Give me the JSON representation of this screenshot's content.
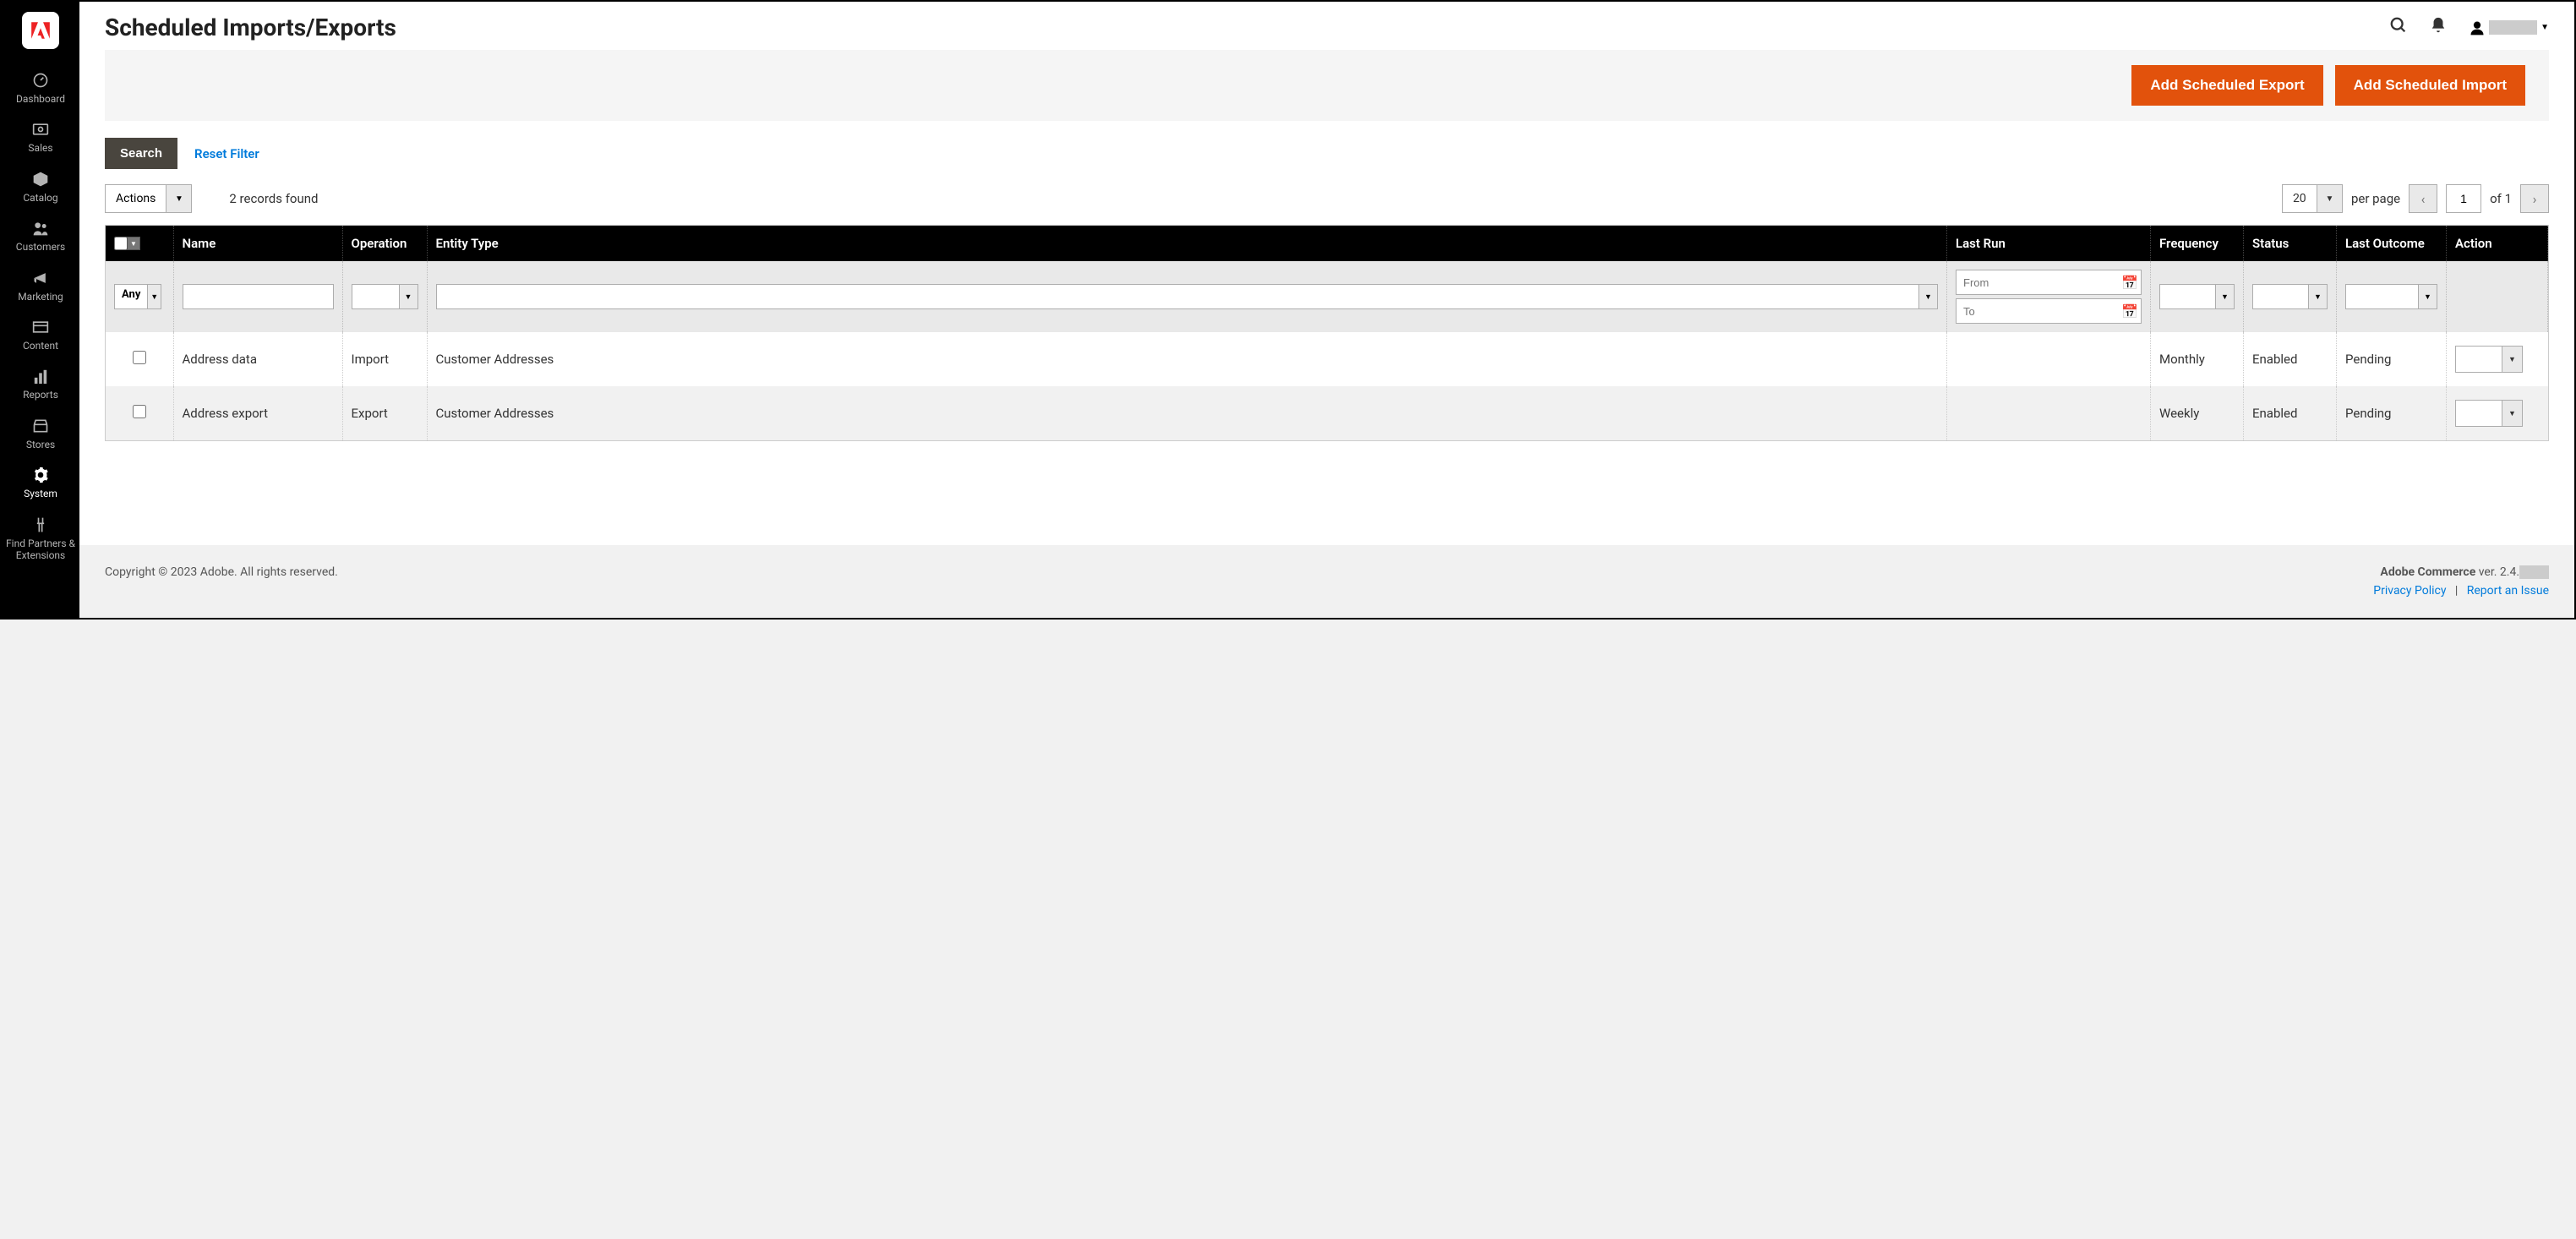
{
  "sidebar": {
    "items": [
      {
        "label": "Dashboard",
        "icon": "dashboard"
      },
      {
        "label": "Sales",
        "icon": "sales"
      },
      {
        "label": "Catalog",
        "icon": "catalog"
      },
      {
        "label": "Customers",
        "icon": "customers"
      },
      {
        "label": "Marketing",
        "icon": "marketing"
      },
      {
        "label": "Content",
        "icon": "content"
      },
      {
        "label": "Reports",
        "icon": "reports"
      },
      {
        "label": "Stores",
        "icon": "stores"
      },
      {
        "label": "System",
        "icon": "system",
        "active": true
      },
      {
        "label": "Find Partners & Extensions",
        "icon": "partners"
      }
    ]
  },
  "header": {
    "title": "Scheduled Imports/Exports"
  },
  "actions": {
    "add_export": "Add Scheduled Export",
    "add_import": "Add Scheduled Import"
  },
  "filter": {
    "search": "Search",
    "reset": "Reset Filter"
  },
  "controls": {
    "actions_label": "Actions",
    "records_found": "2 records found",
    "page_size": "20",
    "per_page": "per page",
    "page": "1",
    "of": "of 1"
  },
  "table": {
    "headers": {
      "name": "Name",
      "operation": "Operation",
      "entity_type": "Entity Type",
      "last_run": "Last Run",
      "frequency": "Frequency",
      "status": "Status",
      "last_outcome": "Last Outcome",
      "action": "Action"
    },
    "filters": {
      "any": "Any",
      "from": "From",
      "to": "To"
    },
    "rows": [
      {
        "name": "Address data",
        "operation": "Import",
        "entity_type": "Customer Addresses",
        "last_run": "",
        "frequency": "Monthly",
        "status": "Enabled",
        "last_outcome": "Pending"
      },
      {
        "name": "Address export",
        "operation": "Export",
        "entity_type": "Customer Addresses",
        "last_run": "",
        "frequency": "Weekly",
        "status": "Enabled",
        "last_outcome": "Pending"
      }
    ]
  },
  "footer": {
    "copyright": "Copyright © 2023 Adobe. All rights reserved.",
    "product": "Adobe Commerce",
    "ver_prefix": " ver. 2.4.",
    "privacy": "Privacy Policy",
    "report": "Report an Issue"
  }
}
